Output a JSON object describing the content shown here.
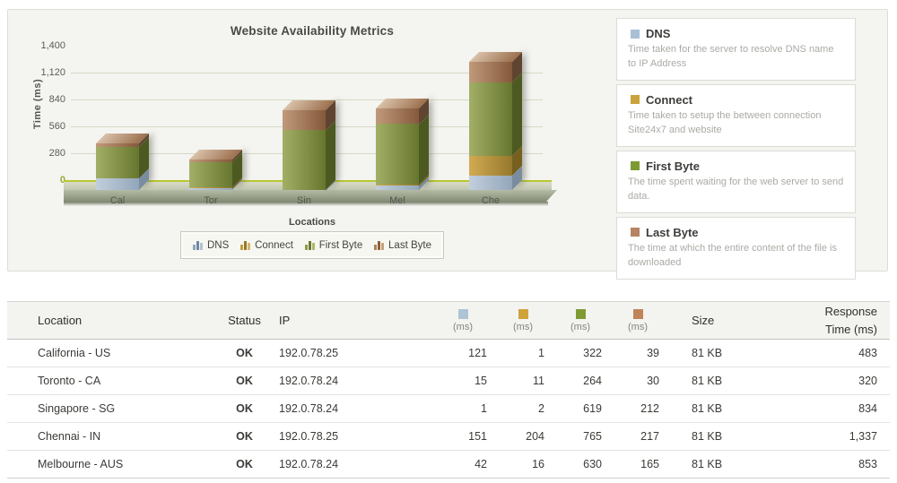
{
  "chart_data": {
    "type": "bar",
    "stacked": true,
    "projection": "3d",
    "title": "Website Availability Metrics",
    "xlabel": "Locations",
    "ylabel": "Time (ms)",
    "categories": [
      "Cal",
      "Tor",
      "Sin",
      "Mel",
      "Che"
    ],
    "series": [
      {
        "name": "DNS",
        "color": "#a9bcce",
        "values": [
          121,
          15,
          1,
          42,
          151
        ]
      },
      {
        "name": "Connect",
        "color": "#c9a23c",
        "values": [
          1,
          11,
          2,
          16,
          204
        ]
      },
      {
        "name": "First Byte",
        "color": "#7e9a33",
        "values": [
          322,
          264,
          619,
          630,
          765
        ]
      },
      {
        "name": "Last Byte",
        "color": "#b58563",
        "values": [
          39,
          30,
          212,
          165,
          217
        ]
      }
    ],
    "totals": [
      483,
      320,
      834,
      853,
      1337
    ],
    "ylim": [
      0,
      1400
    ],
    "yticks": [
      "0",
      "280",
      "560",
      "840",
      "1,120",
      "1,400"
    ],
    "ytick_values": [
      0,
      280,
      560,
      840,
      1120,
      1400
    ],
    "gridlines": [
      280,
      560,
      840,
      1120
    ],
    "legend_position": "bottom",
    "legend": [
      "DNS",
      "Connect",
      "First Byte",
      "Last Byte"
    ]
  },
  "info_cards": [
    {
      "title": "DNS",
      "color": "#a9bfd4",
      "description": "Time taken for the server to resolve DNS name to IP Address"
    },
    {
      "title": "Connect",
      "color": "#c9a23c",
      "description": "Time taken to setup the between connection Site24x7 and website"
    },
    {
      "title": "First Byte",
      "color": "#7e9a33",
      "description": "The time spent waiting for the web server to send data."
    },
    {
      "title": "Last Byte",
      "color": "#b58563",
      "description": "The time at which the entire content of the file is downloaded"
    }
  ],
  "table": {
    "columns": {
      "location": "Location",
      "status": "Status",
      "ip": "IP",
      "ms_label": "(ms)",
      "ms_colors": [
        "#aec4d4",
        "#cfa33a",
        "#7e9a33",
        "#bf8559"
      ],
      "size": "Size",
      "response": "Response Time (ms)"
    },
    "rows": [
      {
        "location": "California - US",
        "status": "OK",
        "ip": "192.0.78.25",
        "dns": "121",
        "connect": "1",
        "first_byte": "322",
        "last_byte": "39",
        "size": "81 KB",
        "response_time": "483"
      },
      {
        "location": "Toronto - CA",
        "status": "OK",
        "ip": "192.0.78.24",
        "dns": "15",
        "connect": "11",
        "first_byte": "264",
        "last_byte": "30",
        "size": "81 KB",
        "response_time": "320"
      },
      {
        "location": "Singapore - SG",
        "status": "OK",
        "ip": "192.0.78.24",
        "dns": "1",
        "connect": "2",
        "first_byte": "619",
        "last_byte": "212",
        "size": "81 KB",
        "response_time": "834"
      },
      {
        "location": "Chennai - IN",
        "status": "OK",
        "ip": "192.0.78.25",
        "dns": "151",
        "connect": "204",
        "first_byte": "765",
        "last_byte": "217",
        "size": "81 KB",
        "response_time": "1,337"
      },
      {
        "location": "Melbourne - AUS",
        "status": "OK",
        "ip": "192.0.78.24",
        "dns": "42",
        "connect": "16",
        "first_byte": "630",
        "last_byte": "165",
        "size": "81 KB",
        "response_time": "853"
      }
    ]
  }
}
